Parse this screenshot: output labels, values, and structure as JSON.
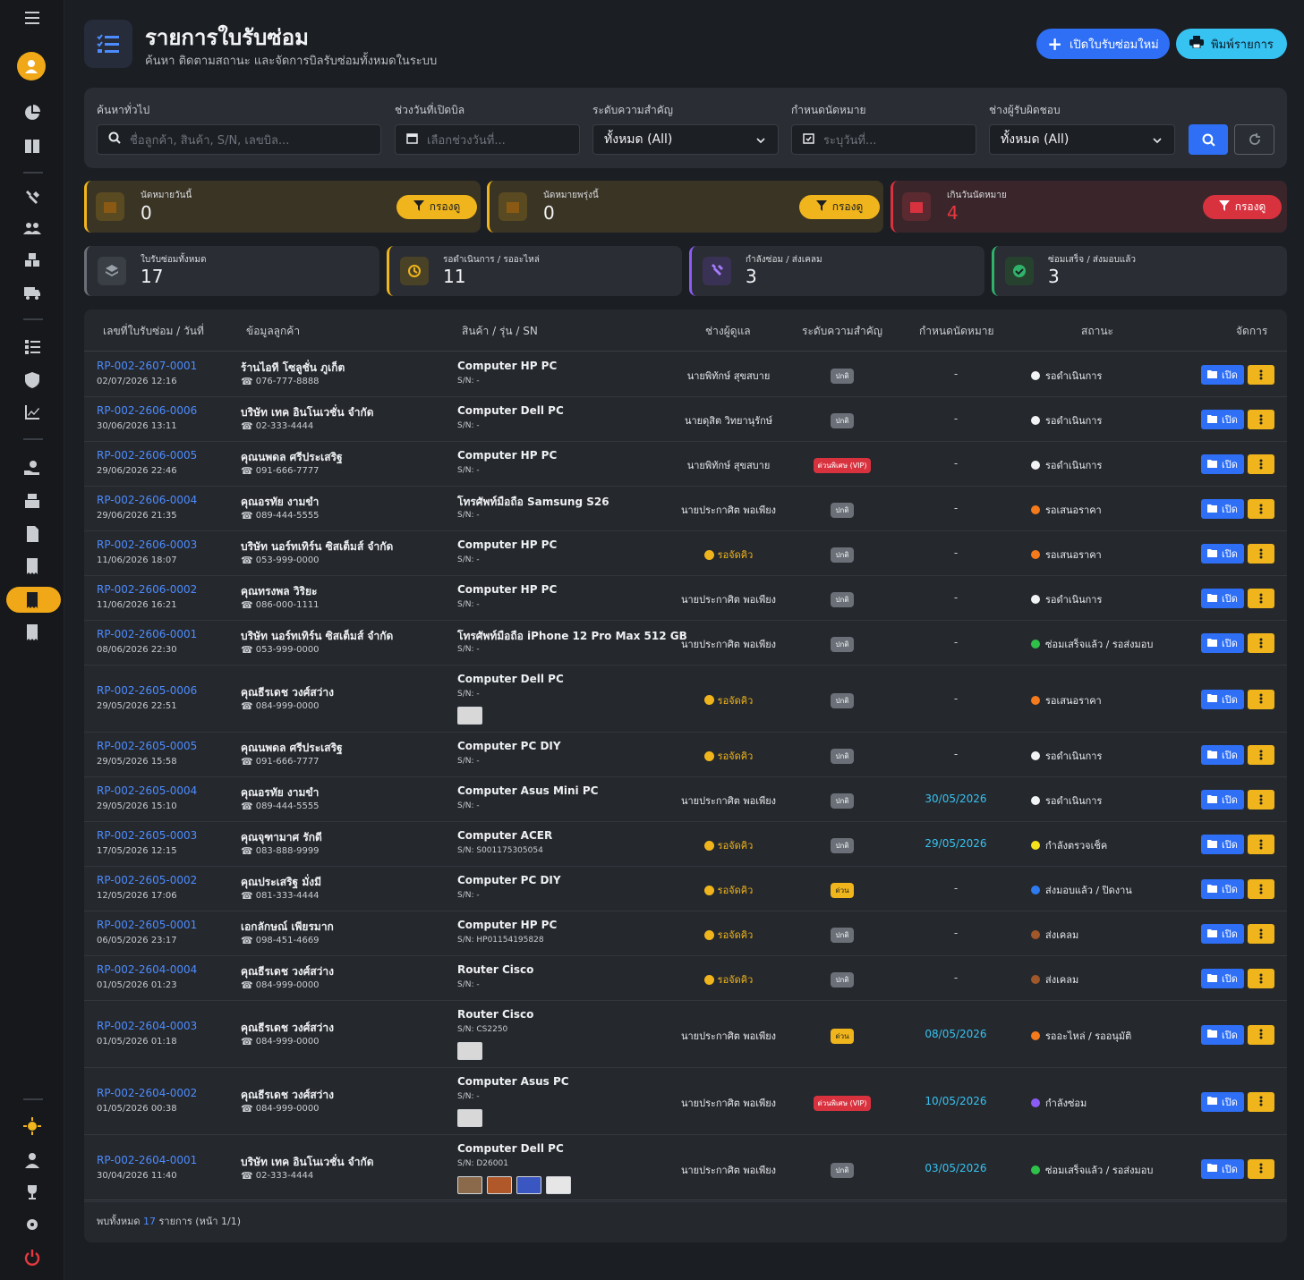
{
  "header": {
    "title": "รายการใบรับซ่อม",
    "subtitle": "ค้นหา ติดตามสถานะ และจัดการบิลรับซ่อมทั้งหมดในระบบ",
    "new_button": "เปิดใบรับซ่อมใหม่",
    "print_button": "พิมพ์รายการ"
  },
  "filters": {
    "search_label": "ค้นหาทั่วไป",
    "search_placeholder": "ชื่อลูกค้า, สินค้า, S/N, เลขบิล...",
    "date_label": "ช่วงวันที่เปิดบิล",
    "date_placeholder": "เลือกช่วงวันที่...",
    "priority_label": "ระดับความสำคัญ",
    "priority_value": "ทั้งหมด (All)",
    "appt_label": "กำหนดนัดหมาย",
    "appt_placeholder": "ระบุวันที่...",
    "tech_label": "ช่างผู้รับผิดชอบ",
    "tech_value": "ทั้งหมด (All)"
  },
  "alerts": [
    {
      "label": "นัดหมายวันนี้",
      "value": "0",
      "button": "กรองดู"
    },
    {
      "label": "นัดหมายพรุ่งนี้",
      "value": "0",
      "button": "กรองดู"
    },
    {
      "label": "เกินวันนัดหมาย",
      "value": "4",
      "button": "กรองดู"
    }
  ],
  "stats": [
    {
      "label": "ใบรับซ่อมทั้งหมด",
      "value": "17"
    },
    {
      "label": "รอดำเนินการ / รออะไหล่",
      "value": "11"
    },
    {
      "label": "กำลังซ่อม / ส่งเคลม",
      "value": "3"
    },
    {
      "label": "ซ่อมเสร็จ / ส่งมอบแล้ว",
      "value": "3"
    }
  ],
  "table": {
    "headers": [
      "เลขที่ใบรับซ่อม / วันที่",
      "ข้อมูลลูกค้า",
      "สินค้า / รุ่น / SN",
      "ช่างผู้ดูแล",
      "ระดับความสำคัญ",
      "กำหนดนัดหมาย",
      "สถานะ",
      "จัดการ"
    ],
    "open_label": "เปิด",
    "rows": [
      {
        "id": "RP-002-2607-0001",
        "date": "02/07/2026 12:16",
        "customer": "ร้านไอที โซลูชั่น ภูเก็ต",
        "phone": "076-777-8888",
        "product": "Computer HP PC",
        "sn": "S/N: -",
        "tech": "นายพิทักษ์ สุขสบาย",
        "priority": "ปกติ",
        "appt": "-",
        "status": "รอดำเนินการ"
      },
      {
        "id": "RP-002-2606-0006",
        "date": "30/06/2026 13:11",
        "customer": "บริษัท เทค อินโนเวชั่น จำกัด",
        "phone": "02-333-4444",
        "product": "Computer Dell PC",
        "sn": "S/N: -",
        "tech": "นายดุสิต วิทยานุรักษ์",
        "priority": "ปกติ",
        "appt": "-",
        "status": "รอดำเนินการ"
      },
      {
        "id": "RP-002-2606-0005",
        "date": "29/06/2026 22:46",
        "customer": "คุณนพดล ศรีประเสริฐ",
        "phone": "091-666-7777",
        "product": "Computer HP PC",
        "sn": "S/N: -",
        "tech": "นายพิทักษ์ สุขสบาย",
        "priority": "ด่วนพิเศษ (VIP)",
        "appt": "-",
        "status": "รอดำเนินการ"
      },
      {
        "id": "RP-002-2606-0004",
        "date": "29/06/2026 21:35",
        "customer": "คุณอรทัย งามขำ",
        "phone": "089-444-5555",
        "product": "โทรศัพท์มือถือ Samsung S26",
        "sn": "S/N: -",
        "tech": "นายประกาศิต พอเพียง",
        "priority": "ปกติ",
        "appt": "-",
        "status": "รอเสนอราคา"
      },
      {
        "id": "RP-002-2606-0003",
        "date": "11/06/2026 18:07",
        "customer": "บริษัท นอร์ทเทิร์น ซิสเต็มส์ จำกัด",
        "phone": "053-999-0000",
        "product": "Computer HP PC",
        "sn": "S/N: -",
        "tech": "รอจัดคิว",
        "priority": "ปกติ",
        "appt": "-",
        "status": "รอเสนอราคา"
      },
      {
        "id": "RP-002-2606-0002",
        "date": "11/06/2026 16:21",
        "customer": "คุณทรงพล วิริยะ",
        "phone": "086-000-1111",
        "product": "Computer HP PC",
        "sn": "S/N: -",
        "tech": "นายประกาศิต พอเพียง",
        "priority": "ปกติ",
        "appt": "-",
        "status": "รอดำเนินการ"
      },
      {
        "id": "RP-002-2606-0001",
        "date": "08/06/2026 22:30",
        "customer": "บริษัท นอร์ทเทิร์น ซิสเต็มส์ จำกัด",
        "phone": "053-999-0000",
        "product": "โทรศัพท์มือถือ iPhone 12 Pro Max 512 GB",
        "sn": "S/N: -",
        "tech": "นายประกาศิต พอเพียง",
        "priority": "ปกติ",
        "appt": "-",
        "status": "ซ่อมเสร็จแล้ว / รอส่งมอบ"
      },
      {
        "id": "RP-002-2605-0006",
        "date": "29/05/2026 22:51",
        "customer": "คุณธีรเดช วงศ์สว่าง",
        "phone": "084-999-0000",
        "product": "Computer Dell PC",
        "sn": "S/N: -",
        "tech": "รอจัดคิว",
        "priority": "ปกติ",
        "appt": "-",
        "status": "รอเสนอราคา"
      },
      {
        "id": "RP-002-2605-0005",
        "date": "29/05/2026 15:58",
        "customer": "คุณนพดล ศรีประเสริฐ",
        "phone": "091-666-7777",
        "product": "Computer PC DIY",
        "sn": "S/N: -",
        "tech": "รอจัดคิว",
        "priority": "ปกติ",
        "appt": "-",
        "status": "รอดำเนินการ"
      },
      {
        "id": "RP-002-2605-0004",
        "date": "29/05/2026 15:10",
        "customer": "คุณอรทัย งามขำ",
        "phone": "089-444-5555",
        "product": "Computer Asus Mini PC",
        "sn": "S/N: -",
        "tech": "นายประกาศิต พอเพียง",
        "priority": "ปกติ",
        "appt": "30/05/2026",
        "status": "รอดำเนินการ"
      },
      {
        "id": "RP-002-2605-0003",
        "date": "17/05/2026 12:15",
        "customer": "คุณจุฑามาศ รักดี",
        "phone": "083-888-9999",
        "product": "Computer ACER",
        "sn": "S/N: S001175305054",
        "tech": "รอจัดคิว",
        "priority": "ปกติ",
        "appt": "29/05/2026",
        "status": "กำลังตรวจเช็ค"
      },
      {
        "id": "RP-002-2605-0002",
        "date": "12/05/2026 17:06",
        "customer": "คุณประเสริฐ มั่งมี",
        "phone": "081-333-4444",
        "product": "Computer PC DIY",
        "sn": "S/N: -",
        "tech": "รอจัดคิว",
        "priority": "ด่วน",
        "appt": "-",
        "status": "ส่งมอบแล้ว / ปิดงาน"
      },
      {
        "id": "RP-002-2605-0001",
        "date": "06/05/2026 23:17",
        "customer": "เอกลักษณ์ เพียรมาก",
        "phone": "098-451-4669",
        "product": "Computer HP PC",
        "sn": "S/N: HP01154195828",
        "tech": "รอจัดคิว",
        "priority": "ปกติ",
        "appt": "-",
        "status": "ส่งเคลม"
      },
      {
        "id": "RP-002-2604-0004",
        "date": "01/05/2026 01:23",
        "customer": "คุณธีรเดช วงศ์สว่าง",
        "phone": "084-999-0000",
        "product": "Router Cisco",
        "sn": "S/N: -",
        "tech": "รอจัดคิว",
        "priority": "ปกติ",
        "appt": "-",
        "status": "ส่งเคลม"
      },
      {
        "id": "RP-002-2604-0003",
        "date": "01/05/2026 01:18",
        "customer": "คุณธีรเดช วงศ์สว่าง",
        "phone": "084-999-0000",
        "product": "Router Cisco",
        "sn": "S/N: CS2250",
        "tech": "นายประกาศิต พอเพียง",
        "priority": "ด่วน",
        "appt": "08/05/2026",
        "status": "รออะไหล่ / รออนุมัติ"
      },
      {
        "id": "RP-002-2604-0002",
        "date": "01/05/2026 00:38",
        "customer": "คุณธีรเดช วงศ์สว่าง",
        "phone": "084-999-0000",
        "product": "Computer Asus PC",
        "sn": "S/N: -",
        "tech": "นายประกาศิต พอเพียง",
        "priority": "ด่วนพิเศษ (VIP)",
        "appt": "10/05/2026",
        "status": "กำลังซ่อม"
      },
      {
        "id": "RP-002-2604-0001",
        "date": "30/04/2026 11:40",
        "customer": "บริษัท เทค อินโนเวชั่น จำกัด",
        "phone": "02-333-4444",
        "product": "Computer Dell PC",
        "sn": "S/N: D26001",
        "tech": "นายประกาศิต พอเพียง",
        "priority": "ปกติ",
        "appt": "03/05/2026",
        "status": "ซ่อมเสร็จแล้ว / รอส่งมอบ"
      }
    ]
  },
  "footer": {
    "prefix": "พบทั้งหมด",
    "count": "17",
    "suffix": "รายการ (หน้า 1/1)"
  },
  "colors": {
    "accent": "#2e6ff5",
    "warning": "#f0b51c",
    "danger": "#d9323f",
    "cyan": "#37c3f2"
  }
}
